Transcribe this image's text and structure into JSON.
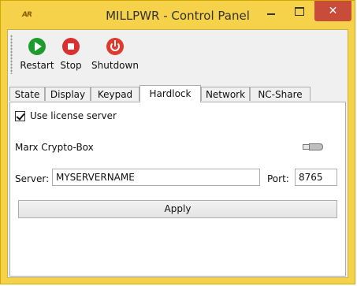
{
  "window": {
    "logo_text": "AR",
    "title": "MILLPWR - Control Panel",
    "minimize_glyph": "—",
    "maximize_glyph": "□",
    "close_glyph": "✕",
    "close_color": "#c94b3a",
    "frame_color": "#f6d24a"
  },
  "toolbar": {
    "restart_label": "Restart",
    "stop_label": "Stop",
    "shutdown_label": "Shutdown",
    "restart_icon": "play-icon",
    "stop_icon": "stop-icon",
    "shutdown_icon": "power-icon"
  },
  "tabs": [
    {
      "label": "State",
      "active": false
    },
    {
      "label": "Display",
      "active": false
    },
    {
      "label": "Keypad",
      "active": false
    },
    {
      "label": "Hardlock",
      "active": true
    },
    {
      "label": "Network",
      "active": false
    },
    {
      "label": "NC-Share",
      "active": false
    }
  ],
  "hardlock": {
    "use_license_server_label": "Use license server",
    "use_license_server_checked": true,
    "device_label": "Marx Crypto-Box",
    "device_icon": "usb-dongle-icon",
    "server_label": "Server:",
    "server_value": "MYSERVERNAME",
    "port_label": "Port:",
    "port_value": "8765",
    "apply_label": "Apply"
  }
}
